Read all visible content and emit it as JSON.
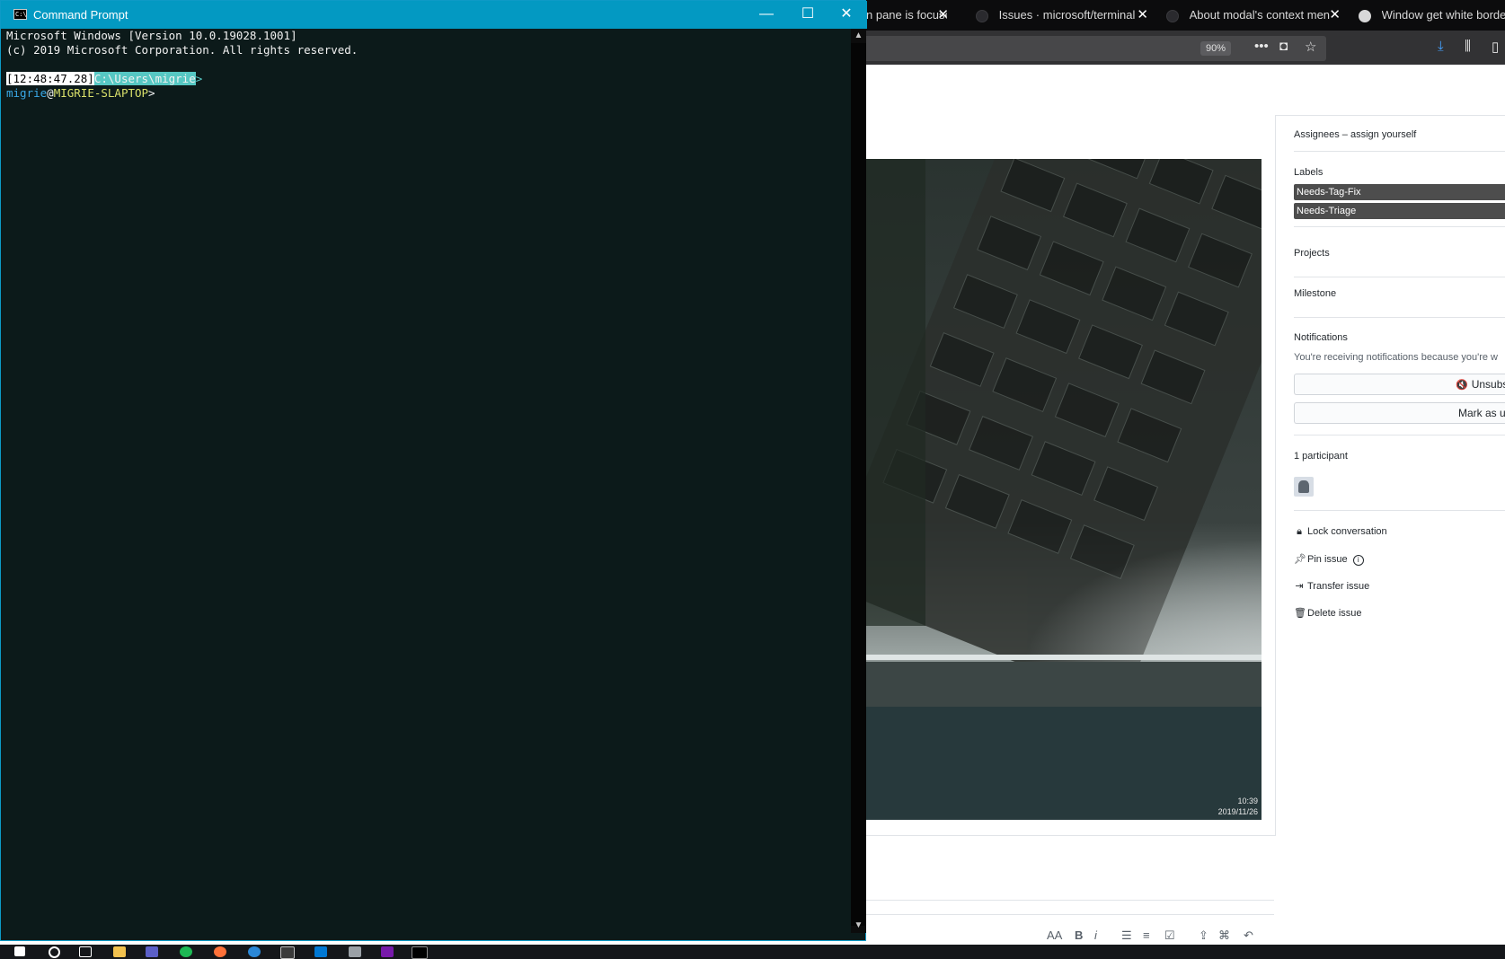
{
  "browser": {
    "tabs": [
      {
        "title": "n pane is focuse",
        "active": false
      },
      {
        "title": "Issues · microsoft/terminal",
        "active": false
      },
      {
        "title": "About modal's context menu",
        "active": false
      },
      {
        "title": "Window get white border v",
        "active": true
      }
    ],
    "zoom": "90%"
  },
  "photo": {
    "time": "10:39",
    "date": "2019/11/26"
  },
  "sidebar": {
    "assignees": "Assignees – assign yourself",
    "labels_heading": "Labels",
    "labels": [
      "Needs-Tag-Fix",
      "Needs-Triage"
    ],
    "projects_heading": "Projects",
    "milestone_heading": "Milestone",
    "notifications_heading": "Notifications",
    "notifications_text": "You're receiving notifications because you're w",
    "unsubscribe_label": "Unsubs",
    "mark_label": "Mark as ur",
    "participants_heading": "1 participant",
    "actions": {
      "lock": "Lock conversation",
      "pin": "Pin issue",
      "transfer": "Transfer issue",
      "delete": "Delete issue"
    }
  },
  "cmd": {
    "title": "Command Prompt",
    "line1": "Microsoft Windows [Version 10.0.19028.1001]",
    "line2": "(c) 2019 Microsoft Corporation. All rights reserved.",
    "timestamp": "[12:48:47.28]",
    "path": "C:\\Users\\migrie",
    "user": "migrie",
    "at": "@",
    "host": "MIGRIE-SLAPTOP",
    "prompt": ">"
  },
  "colors": {
    "cmd_titlebar": "#0399c2",
    "cmd_background": "#0c1a1a",
    "label_chip": "#4d4d4d",
    "taskbar": "#15171a"
  }
}
